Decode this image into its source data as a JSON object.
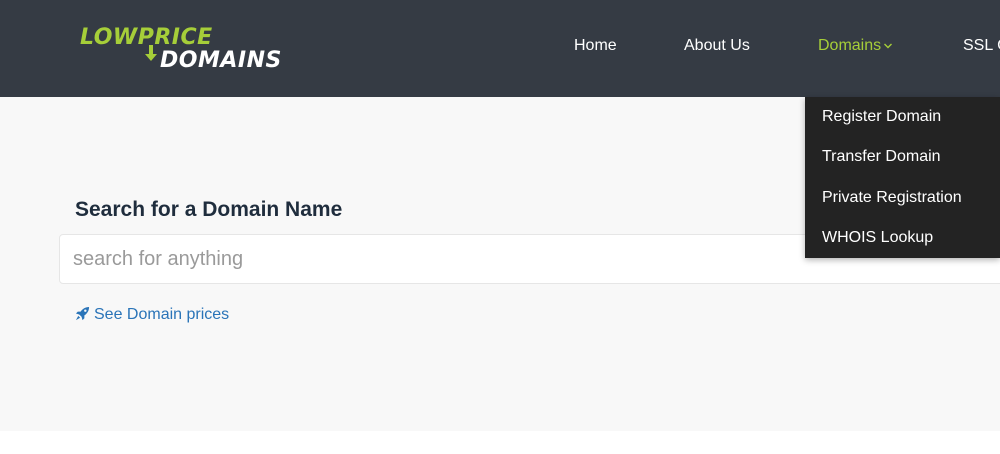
{
  "brand": {
    "line1": "LOWPRICE",
    "line2": "DOMAINS",
    "accent_color": "#a6ce39",
    "header_color": "#353b44"
  },
  "nav": {
    "home": "Home",
    "about": "About Us",
    "domains": "Domains",
    "ssl": "SSL C",
    "active": "Domains"
  },
  "dropdown": {
    "items": [
      "Register Domain",
      "Transfer Domain",
      "Private Registration",
      "WHOIS Lookup"
    ]
  },
  "search": {
    "title": "Search for a Domain Name",
    "placeholder": "search for anything",
    "value": ""
  },
  "prices_link": {
    "icon": "rocket-icon",
    "label": "See Domain prices",
    "color": "#2a74b8"
  }
}
